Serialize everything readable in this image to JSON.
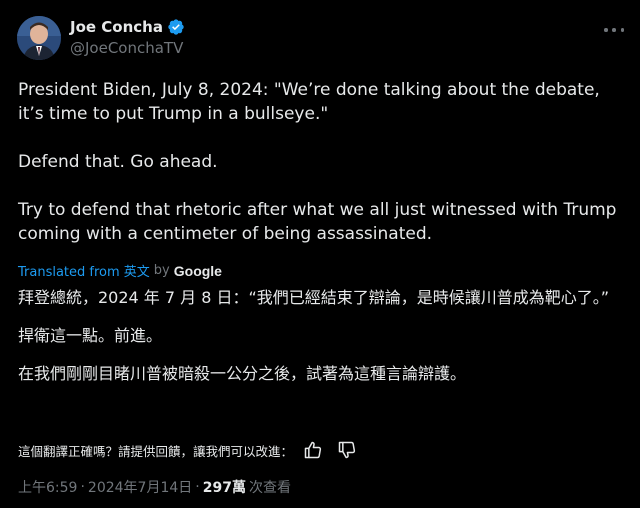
{
  "author": {
    "display_name": "Joe Concha",
    "handle": "@JoeConchaTV",
    "verified": true
  },
  "tweet": {
    "paragraphs": [
      "President Biden, July 8, 2024: \"We’re done talking about the debate, it’s time to put Trump in a bullseye.\"",
      "Defend that. Go ahead.",
      "Try to defend that rhetoric after what we all just witnessed with Trump coming with a centimeter of being assassinated."
    ]
  },
  "translation": {
    "translated_from_label": "Translated from 英文",
    "by_label": "by",
    "provider": "Google",
    "paragraphs": [
      "拜登總統，2024 年 7 月 8 日：“我們已經結束了辯論，是時候讓川普成為靶心了。”",
      "捍衛這一點。前進。",
      "在我們剛剛目睹川普被暗殺一公分之後，試著為這種言論辯護。"
    ],
    "feedback_prompt": "這個翻譯正確嗎？請提供回饋，讓我們可以改進："
  },
  "meta": {
    "time": "上午6:59",
    "date": "2024年7月14日",
    "views_count": "297萬",
    "views_label": "次查看"
  },
  "colors": {
    "background": "#000000",
    "text": "#e7e9ea",
    "secondary": "#71767b",
    "accent": "#1d9bf0"
  },
  "icons": {
    "verified": "verified-badge-icon",
    "more": "more-options-icon",
    "thumbs_up": "thumbs-up-icon",
    "thumbs_down": "thumbs-down-icon"
  }
}
